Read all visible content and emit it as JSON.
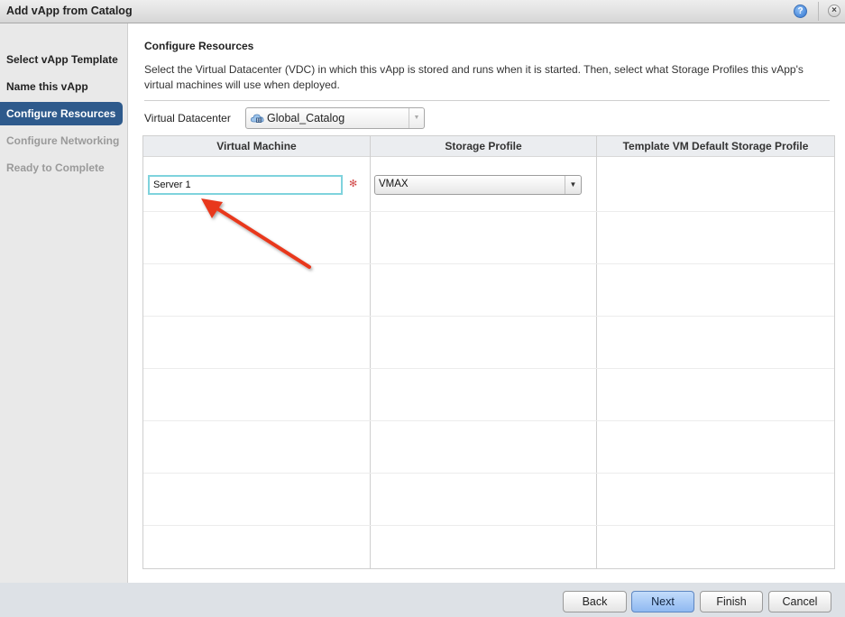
{
  "window": {
    "title": "Add vApp from Catalog",
    "help_icon": "?",
    "close_icon": "×"
  },
  "sidebar": {
    "items": [
      {
        "label": "Select vApp Template",
        "state": "completed"
      },
      {
        "label": "Name this vApp",
        "state": "completed"
      },
      {
        "label": "Configure Resources",
        "state": "active"
      },
      {
        "label": "Configure Networking",
        "state": "disabled"
      },
      {
        "label": "Ready to Complete",
        "state": "disabled"
      }
    ]
  },
  "main": {
    "title": "Configure Resources",
    "description": "Select the Virtual Datacenter (VDC) in which this vApp is stored and runs when it is started. Then, select what Storage Profiles this vApp's virtual machines will use when deployed.",
    "vdc": {
      "label": "Virtual Datacenter",
      "value": "Global_Catalog",
      "icon": "cloud-datacenter-icon",
      "arrow": "▼"
    },
    "table": {
      "columns": [
        "Virtual Machine",
        "Storage Profile",
        "Template VM Default Storage Profile"
      ],
      "rows": [
        {
          "virtual_machine": "Server 1",
          "required_marker": "✻",
          "storage_profile": "VMAX",
          "storage_arrow": "▼",
          "template_default": ""
        }
      ]
    }
  },
  "footer": {
    "back": "Back",
    "next": "Next",
    "finish": "Finish",
    "cancel": "Cancel"
  },
  "colors": {
    "accent": "#2e5a8c",
    "focus_ring": "#7fd3dd",
    "annotation_arrow": "#e8391f",
    "primary_button": "#a9caf6"
  }
}
